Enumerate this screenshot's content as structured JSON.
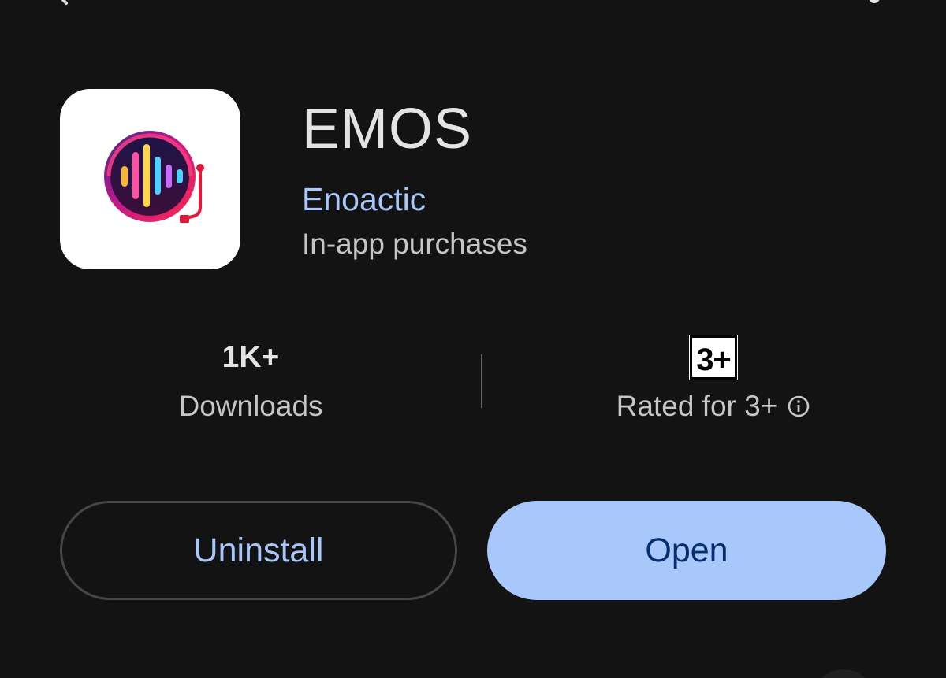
{
  "app": {
    "title": "EMOS",
    "developer": "Enoactic",
    "purchases_note": "In-app purchases",
    "icon": "emos-app-logo"
  },
  "stats": {
    "downloads_value": "1K+",
    "downloads_label": "Downloads",
    "rating_badge": "3+",
    "rating_label": "Rated for 3+",
    "rating_info_icon": "info-icon"
  },
  "actions": {
    "uninstall_label": "Uninstall",
    "open_label": "Open"
  },
  "top_bar": {
    "back_icon": "back-arrow-icon",
    "more_icon": "more-vert-icon"
  },
  "colors": {
    "background": "#131313",
    "accent": "#a8c7fa",
    "open_text": "#062e6f",
    "title_text": "#e3e3e3",
    "secondary_text": "#c4c7c5"
  }
}
